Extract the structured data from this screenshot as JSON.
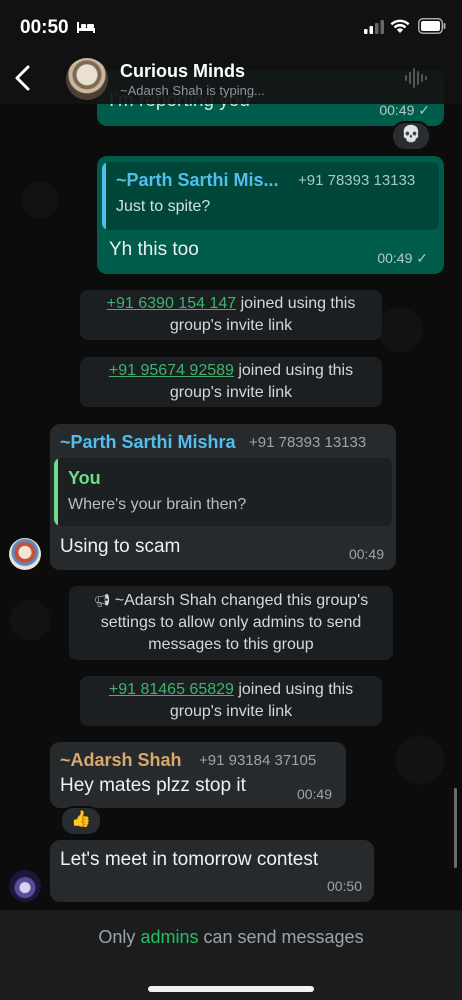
{
  "status_bar": {
    "time": "00:50"
  },
  "header": {
    "group_name": "Curious Minds",
    "typing_status": "~Adarsh Shah is typing..."
  },
  "messages": {
    "m1": {
      "text": "I'm reporting you",
      "time": "00:49",
      "tick": "✓",
      "reaction": "💀"
    },
    "m2": {
      "quote_sender": "~Parth Sarthi Mis...",
      "quote_phone": "+91 78393 13133",
      "quote_text": "Just to spite?",
      "text": "Yh this too",
      "time": "00:49",
      "tick": "✓"
    },
    "sys1": {
      "phone": "+91 6390 154 147",
      "text_a": " joined using this",
      "text_b": "group's invite link"
    },
    "sys2": {
      "phone": "+91 95674 92589",
      "text_a": " joined using this",
      "text_b": "group's invite link"
    },
    "m3": {
      "sender": "~Parth Sarthi Mishra",
      "phone": "+91 78393 13133",
      "quote_sender": "You",
      "quote_text": "Where's your brain then?",
      "text": "Using to scam",
      "time": "00:49"
    },
    "sys3": {
      "line1": "~Adarsh Shah changed this group's",
      "line2": "settings to allow only admins to send",
      "line3": "messages to this group"
    },
    "sys4": {
      "phone": "+91 81465 65829",
      "text_a": " joined using this",
      "text_b": "group's invite link"
    },
    "m4": {
      "sender": "~Adarsh Shah",
      "phone": "+91 93184 37105",
      "text": "Hey mates plzz stop it",
      "time": "00:49",
      "reaction": "👍"
    },
    "m5": {
      "text": "Let's meet in tomorrow contest",
      "time": "00:50"
    }
  },
  "footer": {
    "pre": "Only ",
    "admins": "admins",
    "post": " can send messages"
  },
  "colors": {
    "outgoing_bubble": "#005c4b",
    "incoming_bubble": "#262a2d",
    "parth_name": "#53bdeb",
    "you_name": "#6fdc8c",
    "adarsh_name": "#d9a86c",
    "link_green": "#3fb36f",
    "admins_green": "#21c063"
  }
}
